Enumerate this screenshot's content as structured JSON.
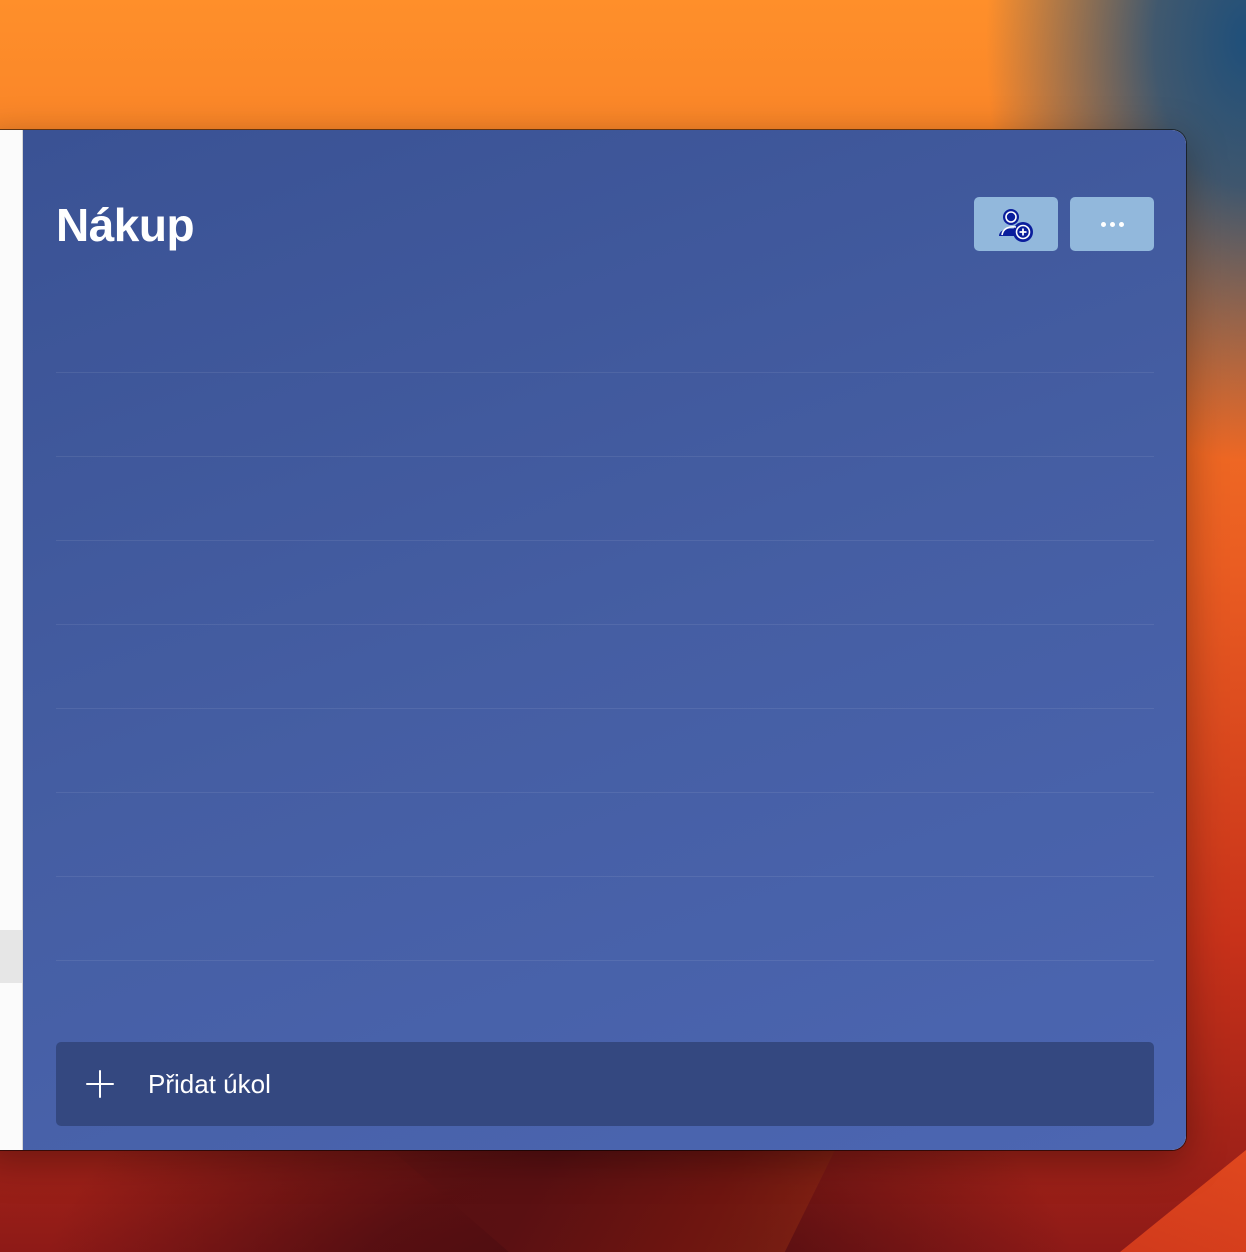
{
  "list": {
    "title": "Nákup"
  },
  "toolbar": {
    "share_icon": "share-person-add-icon",
    "more_icon": "more-horizontal-icon"
  },
  "add_task": {
    "label": "Přidat úkol",
    "icon": "plus-icon"
  },
  "colors": {
    "list_background": "#4158a0",
    "header_button": "#92b8dc",
    "add_task_bar": "#344880",
    "share_icon_fill": "#0a1d9c"
  }
}
